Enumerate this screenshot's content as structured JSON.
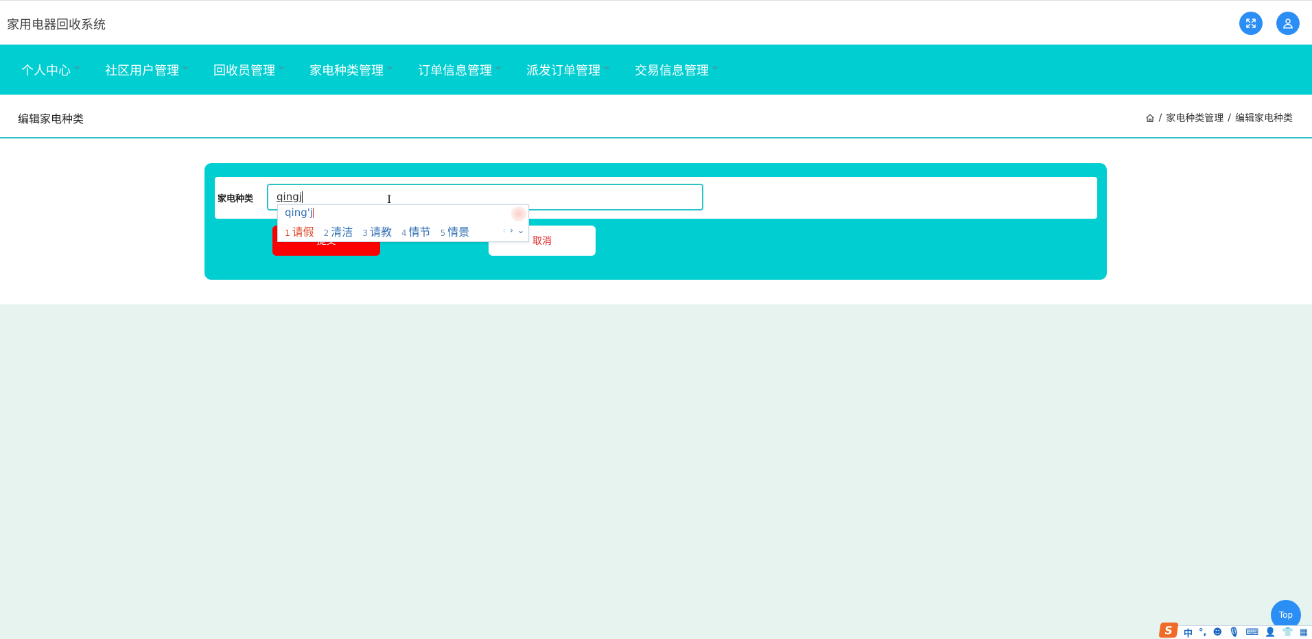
{
  "header": {
    "app_title": "家用电器回收系统",
    "fullscreen_icon": "expand-arrows-icon",
    "user_icon": "user-icon"
  },
  "nav": {
    "items": [
      {
        "label": "个人中心"
      },
      {
        "label": "社区用户管理"
      },
      {
        "label": "回收员管理"
      },
      {
        "label": "家电种类管理"
      },
      {
        "label": "订单信息管理"
      },
      {
        "label": "派发订单管理"
      },
      {
        "label": "交易信息管理"
      }
    ]
  },
  "subheader": {
    "page_title": "编辑家电种类",
    "breadcrumb": {
      "home_icon": "home-icon",
      "separator": "/",
      "items": [
        "家电种类管理",
        "编辑家电种类"
      ]
    }
  },
  "form": {
    "field_label": "家电种类",
    "field_value": "qingj",
    "submit_label": "提交",
    "cancel_label": "取消"
  },
  "ime_popup": {
    "pinyin": "qing'j",
    "candidates": [
      {
        "num": "1",
        "text": "请假"
      },
      {
        "num": "2",
        "text": "清洁"
      },
      {
        "num": "3",
        "text": "请教"
      },
      {
        "num": "4",
        "text": "情节"
      },
      {
        "num": "5",
        "text": "情景"
      }
    ],
    "prev": "‹",
    "next": "›",
    "expand": "⌄"
  },
  "top_button": {
    "label": "Top"
  },
  "ime_toolbar": {
    "logo": "S",
    "items": [
      {
        "name": "chinese-mode-icon",
        "glyph": "中"
      },
      {
        "name": "punctuation-icon",
        "glyph": "°,"
      },
      {
        "name": "emoji-icon",
        "glyph": "☻"
      },
      {
        "name": "microphone-icon",
        "glyph": "🎙"
      },
      {
        "name": "keyboard-icon",
        "glyph": "⌨"
      },
      {
        "name": "user-account-icon",
        "glyph": "👤"
      },
      {
        "name": "skin-icon",
        "glyph": "👕"
      },
      {
        "name": "toolbox-icon",
        "glyph": "▦"
      }
    ]
  }
}
